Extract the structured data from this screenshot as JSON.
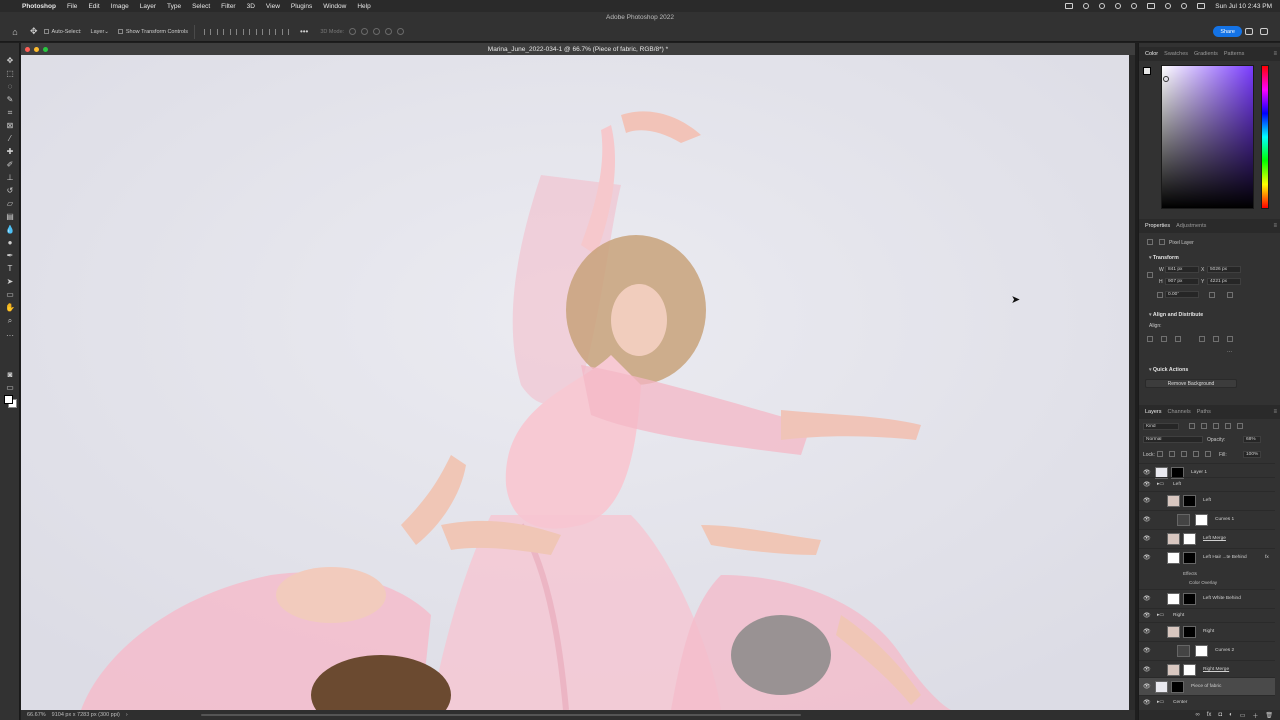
{
  "menubar": {
    "app": "Photoshop",
    "menus": [
      "File",
      "Edit",
      "Image",
      "Layer",
      "Type",
      "Select",
      "Filter",
      "3D",
      "View",
      "Plugins",
      "Window",
      "Help"
    ],
    "window_title": "Adobe Photoshop 2022",
    "clock": "Sun Jul 10  2:43 PM"
  },
  "options": {
    "auto_select": "Auto-Select:",
    "auto_select_target": "Layer",
    "show_transform": "Show Transform Controls",
    "mode_3d": "3D Mode:",
    "share": "Share"
  },
  "document": {
    "tab_title": "Marina_June_2022-034-1 @ 66.7% (Piece of fabric, RGB/8*) *",
    "zoom": "66.67%",
    "dimensions": "9104 px x 7283 px (300 ppi)"
  },
  "panels": {
    "color_tabs": [
      "Color",
      "Swatches",
      "Gradients",
      "Patterns"
    ],
    "properties_tabs": [
      "Properties",
      "Adjustments"
    ],
    "layer_type": "Pixel Layer",
    "transform_title": "Transform",
    "w_label": "W",
    "w_value": "841 px",
    "x_label": "X",
    "x_value": "5026 px",
    "h_label": "H",
    "h_value": "907 px",
    "y_label": "Y",
    "y_value": "4221 px",
    "angle": "0.00°",
    "align_title": "Align and Distribute",
    "align_label": "Align:",
    "quick_title": "Quick Actions",
    "remove_bg": "Remove Background",
    "layers_tabs": [
      "Layers",
      "Channels",
      "Paths"
    ],
    "kind": "Kind",
    "blend": "Normal",
    "opacity_label": "Opacity:",
    "opacity": "68%",
    "lock_label": "Lock:",
    "fill_label": "Fill:",
    "fill": "100%"
  },
  "layers": [
    {
      "name": "Layer 1"
    },
    {
      "name": "Left"
    },
    {
      "name": "Left"
    },
    {
      "name": "Curves 1"
    },
    {
      "name": "Left Merge"
    },
    {
      "name": "Left Hair ...te Behind"
    },
    {
      "name": "Effects"
    },
    {
      "name": "Color Overlay"
    },
    {
      "name": "Left White Behind"
    },
    {
      "name": "Right"
    },
    {
      "name": "Right"
    },
    {
      "name": "Curves 2"
    },
    {
      "name": "Right Merge"
    },
    {
      "name": "Piece of fabric"
    },
    {
      "name": "Center"
    }
  ],
  "colors": {
    "accent": "#1473e6",
    "canvas_bg": "#e4e4ec",
    "panel": "#323232"
  }
}
